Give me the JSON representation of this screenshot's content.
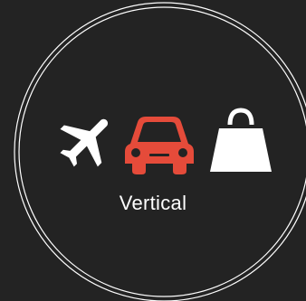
{
  "badge": {
    "label": "Vertical",
    "icons": [
      {
        "name": "airplane-icon",
        "color": "#ffffff"
      },
      {
        "name": "car-icon",
        "color": "#e54b3a"
      },
      {
        "name": "shopping-bag-icon",
        "color": "#ffffff"
      }
    ],
    "colors": {
      "background": "#232323",
      "ring": "#ffffff",
      "accent": "#e54b3a",
      "text": "#ffffff"
    }
  }
}
